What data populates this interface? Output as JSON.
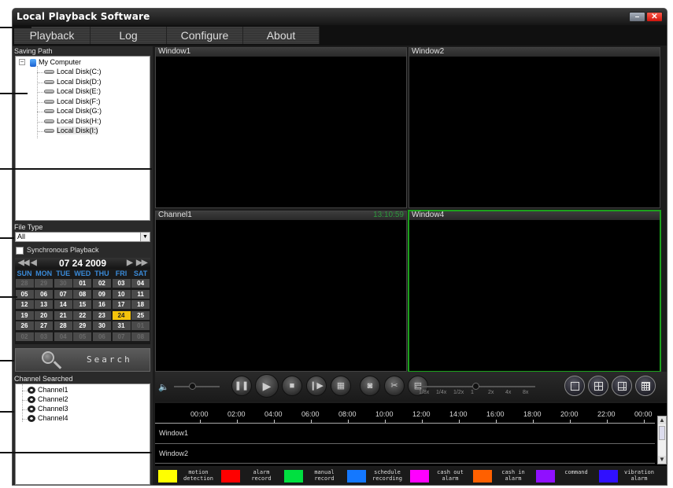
{
  "window": {
    "title": "Local Playback Software",
    "minimize_label": "–",
    "close_label": "✕"
  },
  "menu": [
    {
      "label": "Playback"
    },
    {
      "label": "Log"
    },
    {
      "label": "Configure"
    },
    {
      "label": "About"
    }
  ],
  "sidebar": {
    "saving_path_label": "Saving Path",
    "tree_root": "My Computer",
    "expander": "−",
    "disks": [
      {
        "label": "Local Disk(C:)"
      },
      {
        "label": "Local Disk(D:)"
      },
      {
        "label": "Local Disk(E:)"
      },
      {
        "label": "Local Disk(F:)"
      },
      {
        "label": "Local Disk(G:)"
      },
      {
        "label": "Local Disk(H:)"
      },
      {
        "label": "Local Disk(I:)",
        "selected": true
      }
    ],
    "file_type_label": "File Type",
    "file_type_value": "All",
    "dropdown_arrow": "▼",
    "sync_playback_label": "Synchronous Playback",
    "sync_playback_checked": false,
    "calendar": {
      "date": "07 24 2009",
      "prev_year": "◀◀",
      "prev_month": "◀",
      "next_month": "▶",
      "next_year": "▶▶",
      "dow": [
        "SUN",
        "MON",
        "TUE",
        "WED",
        "THU",
        "FRI",
        "SAT"
      ],
      "weeks": [
        [
          "28",
          "29",
          "30",
          "01",
          "02",
          "03",
          "04"
        ],
        [
          "05",
          "06",
          "07",
          "08",
          "09",
          "10",
          "11"
        ],
        [
          "12",
          "13",
          "14",
          "15",
          "16",
          "17",
          "18"
        ],
        [
          "19",
          "20",
          "21",
          "22",
          "23",
          "24",
          "25"
        ],
        [
          "26",
          "27",
          "28",
          "29",
          "30",
          "31",
          "01"
        ],
        [
          "02",
          "03",
          "04",
          "05",
          "06",
          "07",
          "08"
        ]
      ],
      "selected_day": "24",
      "highlight_color": "#f4c30c"
    },
    "search_label": "Search",
    "channel_searched_label": "Channel Searched",
    "channels": [
      {
        "label": "Channel1"
      },
      {
        "label": "Channel2"
      },
      {
        "label": "Channel3"
      },
      {
        "label": "Channel4"
      }
    ]
  },
  "video": {
    "windows": [
      {
        "name": "Window1",
        "time": ""
      },
      {
        "name": "Window2",
        "time": ""
      },
      {
        "name": "Channel1",
        "time": "13:10:59"
      },
      {
        "name": "Window4",
        "time": "",
        "active": true
      }
    ],
    "active_border_color": "#1ca21c"
  },
  "controls": {
    "volume_icon": "🔈",
    "volume_level": 0.4,
    "buttons": [
      {
        "name": "pause-button",
        "glyph": "❚❚"
      },
      {
        "name": "play-button",
        "glyph": "▶"
      },
      {
        "name": "stop-button",
        "glyph": "■"
      },
      {
        "name": "step-forward-button",
        "glyph": "❙▶"
      },
      {
        "name": "fullscreen-button",
        "glyph": "▦"
      },
      {
        "name": "snapshot-button",
        "glyph": "◙"
      },
      {
        "name": "clip-button",
        "glyph": "✂"
      },
      {
        "name": "file-button",
        "glyph": "▤"
      }
    ],
    "speeds": [
      "1/8x",
      "1/4x",
      "1/2x",
      "1",
      "2x",
      "4x",
      "8x"
    ],
    "current_speed": "1",
    "layouts": [
      {
        "name": "layout-1-button"
      },
      {
        "name": "layout-4-button"
      },
      {
        "name": "layout-6-button"
      },
      {
        "name": "layout-16-button"
      }
    ]
  },
  "timeline": {
    "ticks": [
      "00:00",
      "02:00",
      "04:00",
      "06:00",
      "08:00",
      "10:00",
      "12:00",
      "14:00",
      "16:00",
      "18:00",
      "20:00",
      "22:00",
      "00:00"
    ],
    "rows": [
      "Window1",
      "Window2"
    ],
    "scroll_up": "▲",
    "scroll_down": "▼"
  },
  "legend": [
    {
      "color": "#ffff00",
      "label": "motion\ndetection"
    },
    {
      "color": "#ff0000",
      "label": "alarm\nrecord"
    },
    {
      "color": "#00e040",
      "label": "manual\nrecord"
    },
    {
      "color": "#1478ff",
      "label": "schedule\nrecording"
    },
    {
      "color": "#ff00ff",
      "label": "cash out\nalarm"
    },
    {
      "color": "#ff6000",
      "label": "cash in\nalarm"
    },
    {
      "color": "#9010ff",
      "label": "command"
    },
    {
      "color": "#3010ff",
      "label": "vibration\nalarm"
    }
  ]
}
